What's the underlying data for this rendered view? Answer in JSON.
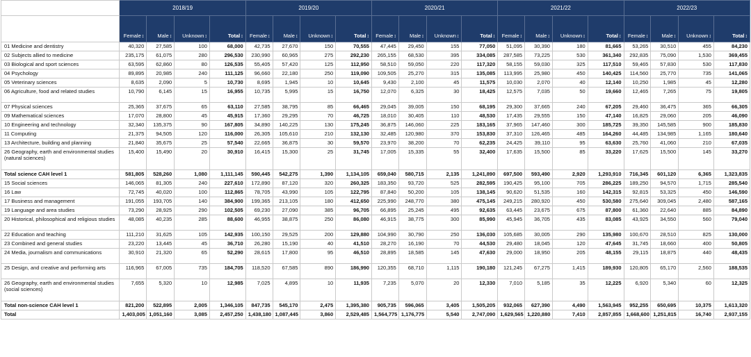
{
  "years": [
    "2018/19",
    "2019/20",
    "2020/21",
    "2021/22",
    "2022/23"
  ],
  "columns": [
    "Female",
    "Male",
    "Unknown",
    "Total"
  ],
  "sort_icon": "sort-arrows-icon",
  "rows": [
    {
      "subject": "01 Medicine and dentistry",
      "values": [
        "40,320",
        "27,585",
        "100",
        "68,000",
        "42,735",
        "27,670",
        "150",
        "70,555",
        "47,445",
        "29,450",
        "155",
        "77,050",
        "51,095",
        "30,390",
        "180",
        "81,665",
        "53,265",
        "30,510",
        "455",
        "84,230"
      ]
    },
    {
      "subject": "02 Subjects allied to medicine",
      "values": [
        "235,175",
        "61,075",
        "280",
        "296,530",
        "230,990",
        "60,965",
        "275",
        "292,230",
        "265,155",
        "68,530",
        "395",
        "334,085",
        "287,585",
        "73,225",
        "530",
        "361,340",
        "292,835",
        "75,090",
        "1,530",
        "369,455"
      ]
    },
    {
      "subject": "03 Biological and sport sciences",
      "values": [
        "63,595",
        "62,860",
        "80",
        "126,535",
        "55,405",
        "57,420",
        "125",
        "112,950",
        "58,510",
        "59,050",
        "220",
        "117,320",
        "58,155",
        "59,030",
        "325",
        "117,510",
        "59,465",
        "57,830",
        "530",
        "117,830"
      ]
    },
    {
      "subject": "04 Psychology",
      "values": [
        "89,895",
        "20,985",
        "240",
        "111,125",
        "96,660",
        "22,180",
        "250",
        "119,090",
        "109,505",
        "25,270",
        "315",
        "135,085",
        "113,995",
        "25,980",
        "450",
        "140,425",
        "114,560",
        "25,770",
        "735",
        "141,065"
      ]
    },
    {
      "subject": "05 Veterinary sciences",
      "values": [
        "8,635",
        "2,090",
        "5",
        "10,730",
        "8,695",
        "1,945",
        "10",
        "10,645",
        "9,430",
        "2,100",
        "45",
        "11,575",
        "10,030",
        "2,070",
        "40",
        "12,140",
        "10,250",
        "1,985",
        "45",
        "12,280"
      ]
    },
    {
      "subject": "06 Agriculture, food and related studies",
      "values": [
        "10,790",
        "6,145",
        "15",
        "16,955",
        "10,735",
        "5,995",
        "15",
        "16,750",
        "12,070",
        "6,325",
        "30",
        "18,425",
        "12,575",
        "7,035",
        "50",
        "19,660",
        "12,465",
        "7,265",
        "75",
        "19,805"
      ]
    },
    {
      "subject": "07 Physical sciences",
      "values": [
        "25,365",
        "37,675",
        "65",
        "63,110",
        "27,585",
        "38,795",
        "85",
        "66,465",
        "29,045",
        "39,005",
        "150",
        "68,195",
        "29,300",
        "37,665",
        "240",
        "67,205",
        "29,460",
        "36,475",
        "365",
        "66,305"
      ]
    },
    {
      "subject": "09 Mathematical sciences",
      "values": [
        "17,070",
        "28,800",
        "45",
        "45,915",
        "17,360",
        "29,295",
        "70",
        "46,725",
        "18,010",
        "30,405",
        "110",
        "48,530",
        "17,435",
        "29,555",
        "150",
        "47,140",
        "16,825",
        "29,060",
        "205",
        "46,090"
      ]
    },
    {
      "subject": "10 Engineering and technology",
      "values": [
        "32,340",
        "135,375",
        "90",
        "167,805",
        "34,890",
        "140,225",
        "130",
        "175,245",
        "36,875",
        "146,060",
        "225",
        "183,165",
        "37,965",
        "147,460",
        "300",
        "185,725",
        "39,350",
        "145,585",
        "900",
        "185,830"
      ]
    },
    {
      "subject": "11 Computing",
      "values": [
        "21,375",
        "94,505",
        "120",
        "116,000",
        "26,305",
        "105,610",
        "210",
        "132,130",
        "32,485",
        "120,980",
        "370",
        "153,830",
        "37,310",
        "126,465",
        "485",
        "164,260",
        "44,485",
        "134,985",
        "1,165",
        "180,640"
      ]
    },
    {
      "subject": "13 Architecture, building and planning",
      "values": [
        "21,840",
        "35,675",
        "25",
        "57,540",
        "22,665",
        "36,875",
        "30",
        "59,570",
        "23,970",
        "38,200",
        "70",
        "62,235",
        "24,425",
        "39,110",
        "95",
        "63,630",
        "25,760",
        "41,060",
        "210",
        "67,035"
      ]
    },
    {
      "subject": "26 Geography, earth and environmental studies (natural sciences)",
      "values": [
        "15,400",
        "15,490",
        "20",
        "30,910",
        "16,415",
        "15,300",
        "25",
        "31,745",
        "17,005",
        "15,335",
        "55",
        "32,400",
        "17,635",
        "15,500",
        "85",
        "33,220",
        "17,625",
        "15,500",
        "145",
        "33,270"
      ]
    },
    {
      "subject": "Total science CAH level 1",
      "values": [
        "581,805",
        "528,260",
        "1,080",
        "1,111,145",
        "590,445",
        "542,275",
        "1,390",
        "1,134,105",
        "659,040",
        "580,715",
        "2,135",
        "1,241,890",
        "697,500",
        "593,490",
        "2,920",
        "1,293,910",
        "716,345",
        "601,120",
        "6,365",
        "1,323,835"
      ]
    },
    {
      "subject": "15 Social sciences",
      "values": [
        "146,065",
        "81,305",
        "240",
        "227,610",
        "172,890",
        "87,120",
        "320",
        "260,325",
        "183,350",
        "93,720",
        "525",
        "282,595",
        "190,425",
        "95,100",
        "705",
        "286,225",
        "189,250",
        "94,570",
        "1,715",
        "285,540"
      ]
    },
    {
      "subject": "16 Law",
      "values": [
        "72,745",
        "40,020",
        "100",
        "112,865",
        "78,705",
        "43,990",
        "105",
        "122,795",
        "87,840",
        "50,200",
        "105",
        "138,145",
        "90,620",
        "51,535",
        "160",
        "142,315",
        "92,815",
        "53,325",
        "450",
        "146,590"
      ]
    },
    {
      "subject": "17 Business and management",
      "values": [
        "191,055",
        "193,705",
        "140",
        "384,900",
        "199,365",
        "213,105",
        "180",
        "412,650",
        "225,990",
        "248,770",
        "380",
        "475,145",
        "249,215",
        "280,920",
        "450",
        "530,580",
        "275,640",
        "309,045",
        "2,480",
        "587,165"
      ]
    },
    {
      "subject": "19 Language and area studies",
      "values": [
        "73,290",
        "28,925",
        "290",
        "102,505",
        "69,230",
        "27,090",
        "385",
        "96,705",
        "66,895",
        "25,245",
        "495",
        "92,635",
        "63,445",
        "23,675",
        "675",
        "87,800",
        "61,360",
        "22,640",
        "885",
        "84,890"
      ]
    },
    {
      "subject": "20 Historical, philosophical and religious studies",
      "values": [
        "48,085",
        "40,235",
        "285",
        "88,600",
        "46,955",
        "38,875",
        "250",
        "86,080",
        "46,915",
        "38,775",
        "300",
        "85,990",
        "45,945",
        "36,705",
        "435",
        "83,085",
        "43,925",
        "34,550",
        "560",
        "79,040"
      ]
    },
    {
      "subject": "22 Education and teaching",
      "values": [
        "111,210",
        "31,625",
        "105",
        "142,935",
        "100,150",
        "29,525",
        "200",
        "129,880",
        "104,990",
        "30,790",
        "250",
        "136,030",
        "105,685",
        "30,005",
        "290",
        "135,980",
        "100,670",
        "28,510",
        "825",
        "130,000"
      ]
    },
    {
      "subject": "23 Combined and general studies",
      "values": [
        "23,220",
        "13,445",
        "45",
        "36,710",
        "26,280",
        "15,190",
        "40",
        "41,510",
        "28,270",
        "16,190",
        "70",
        "44,530",
        "29,480",
        "18,045",
        "120",
        "47,645",
        "31,745",
        "18,660",
        "400",
        "50,805"
      ]
    },
    {
      "subject": "24 Media, journalism and communications",
      "values": [
        "30,910",
        "21,320",
        "65",
        "52,290",
        "28,615",
        "17,800",
        "95",
        "46,510",
        "28,895",
        "18,585",
        "145",
        "47,630",
        "29,000",
        "18,950",
        "205",
        "48,155",
        "29,115",
        "18,875",
        "440",
        "48,435"
      ]
    },
    {
      "subject": "25 Design, and creative and performing arts",
      "values": [
        "116,965",
        "67,005",
        "735",
        "184,705",
        "118,520",
        "67,585",
        "890",
        "186,990",
        "120,355",
        "68,710",
        "1,115",
        "190,180",
        "121,245",
        "67,275",
        "1,415",
        "189,930",
        "120,805",
        "65,170",
        "2,560",
        "188,535"
      ]
    },
    {
      "subject": "26 Geography, earth and environmental studies (social sciences)",
      "values": [
        "7,655",
        "5,320",
        "10",
        "12,985",
        "7,025",
        "4,895",
        "10",
        "11,935",
        "7,235",
        "5,070",
        "20",
        "12,330",
        "7,010",
        "5,185",
        "35",
        "12,225",
        "6,920",
        "5,340",
        "60",
        "12,325"
      ]
    },
    {
      "subject": "Total non-science CAH level 1",
      "values": [
        "821,200",
        "522,895",
        "2,005",
        "1,346,105",
        "847,735",
        "545,170",
        "2,475",
        "1,395,380",
        "905,735",
        "596,065",
        "3,405",
        "1,505,205",
        "932,065",
        "627,390",
        "4,490",
        "1,563,945",
        "952,255",
        "650,695",
        "10,375",
        "1,613,320"
      ]
    },
    {
      "subject": "Total",
      "values": [
        "1,403,005",
        "1,051,160",
        "3,085",
        "2,457,250",
        "1,438,180",
        "1,087,445",
        "3,860",
        "2,529,485",
        "1,564,775",
        "1,176,775",
        "5,540",
        "2,747,090",
        "1,629,565",
        "1,220,880",
        "7,410",
        "2,857,855",
        "1,668,600",
        "1,251,815",
        "16,740",
        "2,937,155"
      ]
    }
  ]
}
